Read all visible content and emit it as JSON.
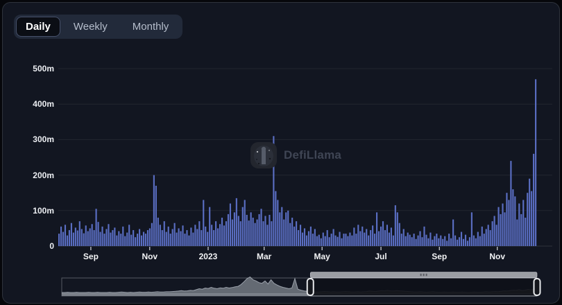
{
  "tabs": {
    "items": [
      {
        "label": "Daily",
        "active": true
      },
      {
        "label": "Weekly",
        "active": false
      },
      {
        "label": "Monthly",
        "active": false
      }
    ]
  },
  "watermark": {
    "text": "DefiLlama"
  },
  "colors": {
    "bar": "#5a6ec3",
    "card_bg": "#121621",
    "tab_container": "#222a3a",
    "active_tab_bg": "#0b0e15",
    "grid": "rgba(255,255,255,0.07)",
    "axis_text": "#eceef2",
    "minimap_fill": "#6e737c",
    "navigator_border": "#9aa0a8"
  },
  "chart_data": {
    "type": "bar",
    "title": "",
    "xlabel": "",
    "ylabel": "",
    "unit": "m",
    "ylim": [
      0,
      500
    ],
    "grid": true,
    "legend_position": "none",
    "y_ticks": [
      "0",
      "100m",
      "200m",
      "300m",
      "400m",
      "500m"
    ],
    "x_ticks": [
      "Sep",
      "Nov",
      "2023",
      "Mar",
      "May",
      "Jul",
      "Sep",
      "Nov"
    ],
    "x_tick_fracs": [
      0.068,
      0.191,
      0.313,
      0.43,
      0.551,
      0.674,
      0.796,
      0.917
    ],
    "values": [
      35,
      55,
      40,
      60,
      30,
      45,
      65,
      38,
      52,
      44,
      70,
      48,
      36,
      58,
      42,
      50,
      62,
      45,
      105,
      68,
      40,
      55,
      35,
      48,
      62,
      38,
      45,
      52,
      30,
      42,
      35,
      55,
      28,
      38,
      60,
      32,
      45,
      25,
      35,
      48,
      30,
      40,
      35,
      45,
      50,
      65,
      200,
      170,
      80,
      60,
      45,
      70,
      40,
      55,
      35,
      48,
      65,
      38,
      50,
      42,
      58,
      35,
      45,
      30,
      52,
      38,
      60,
      48,
      70,
      45,
      130,
      55,
      40,
      110,
      60,
      45,
      70,
      50,
      62,
      80,
      58,
      70,
      90,
      120,
      75,
      95,
      135,
      85,
      70,
      110,
      130,
      88,
      72,
      95,
      80,
      65,
      75,
      90,
      105,
      70,
      85,
      60,
      88,
      70,
      310,
      155,
      130,
      95,
      110,
      75,
      95,
      100,
      65,
      80,
      55,
      70,
      45,
      60,
      38,
      50,
      30,
      42,
      55,
      35,
      48,
      28,
      32,
      22,
      38,
      28,
      45,
      25,
      35,
      48,
      30,
      26,
      40,
      22,
      35,
      35,
      28,
      38,
      30,
      52,
      35,
      60,
      42,
      55,
      38,
      48,
      30,
      45,
      58,
      35,
      95,
      42,
      55,
      70,
      45,
      60,
      38,
      52,
      30,
      115,
      95,
      65,
      35,
      48,
      28,
      38,
      32,
      25,
      35,
      20,
      30,
      42,
      25,
      55,
      32,
      22,
      38,
      18,
      28,
      35,
      22,
      30,
      20,
      28,
      15,
      35,
      22,
      75,
      30,
      18,
      25,
      40,
      20,
      32,
      15,
      25,
      95,
      30,
      22,
      40,
      28,
      55,
      35,
      48,
      60,
      45,
      70,
      85,
      60,
      110,
      90,
      120,
      95,
      150,
      130,
      240,
      160,
      140,
      75,
      120,
      90,
      130,
      80,
      150,
      190,
      155,
      260,
      470
    ]
  },
  "navigator": {
    "selection_start_frac": 0.523,
    "selection_end_frac": 1.0,
    "minimap_values": [
      6,
      6,
      7,
      6,
      6,
      7,
      6,
      6,
      6,
      7,
      6,
      6,
      7,
      6,
      6,
      6,
      7,
      6,
      6,
      7,
      8,
      7,
      6,
      7,
      6,
      7,
      8,
      7,
      7,
      8,
      7,
      8,
      9,
      8,
      8,
      9,
      9,
      10,
      11,
      12,
      14,
      12,
      13,
      15,
      14,
      18,
      22,
      20,
      25,
      23,
      28,
      24,
      22,
      26,
      24,
      28,
      25,
      27,
      30,
      32,
      40,
      52,
      65,
      72,
      60,
      55,
      48,
      45,
      55,
      42,
      60,
      45,
      38,
      32,
      28,
      25,
      22,
      25,
      65,
      20,
      16,
      13,
      11,
      10,
      9,
      8,
      8,
      9,
      10,
      9,
      8,
      9,
      8,
      8,
      9,
      10,
      9,
      8,
      8,
      9,
      8,
      9,
      10,
      12,
      11,
      10,
      12,
      14,
      13,
      15,
      13,
      12,
      14,
      13,
      12,
      11,
      10,
      9,
      8,
      8,
      9,
      8,
      7,
      8,
      9,
      8,
      7,
      7,
      8,
      7,
      7,
      8,
      7,
      7,
      8,
      7,
      6,
      7,
      8,
      7,
      7,
      8,
      9,
      8,
      9,
      10,
      9,
      11,
      13,
      12,
      14,
      16,
      15,
      18,
      14,
      16,
      19,
      17,
      22,
      40
    ]
  }
}
